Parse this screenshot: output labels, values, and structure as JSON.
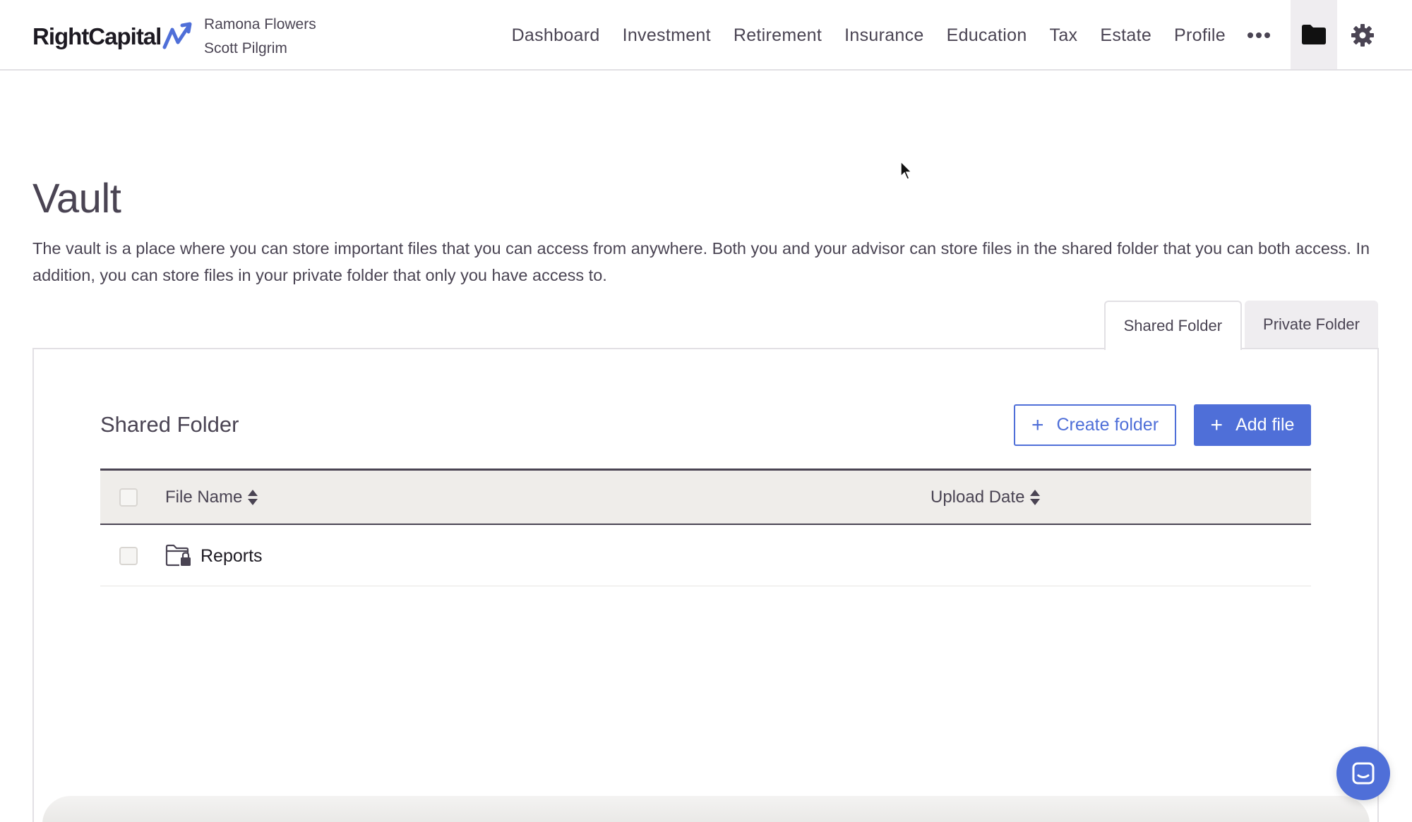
{
  "brand": {
    "name": "RightCapital",
    "accent": "#4f6fd8"
  },
  "clients": [
    "Ramona Flowers",
    "Scott Pilgrim"
  ],
  "nav": {
    "items": [
      "Dashboard",
      "Investment",
      "Retirement",
      "Insurance",
      "Education",
      "Tax",
      "Estate",
      "Profile"
    ],
    "more_icon": "more-dots-icon",
    "vault_icon": "folder-icon",
    "settings_icon": "gear-icon"
  },
  "page": {
    "title": "Vault",
    "description": "The vault is a place where you can store important files that you can access from anywhere. Both you and your advisor can store files in the shared folder that you can both access. In addition, you can store files in your private folder that only you have access to."
  },
  "tabs": [
    {
      "label": "Shared Folder",
      "active": true
    },
    {
      "label": "Private Folder",
      "active": false
    }
  ],
  "folder": {
    "title": "Shared Folder",
    "create_folder_label": "Create folder",
    "add_file_label": "Add file"
  },
  "table": {
    "columns": [
      "File Name",
      "Upload Date"
    ],
    "rows": [
      {
        "name": "Reports",
        "upload_date": "",
        "icon": "locked-folder-icon"
      }
    ]
  }
}
